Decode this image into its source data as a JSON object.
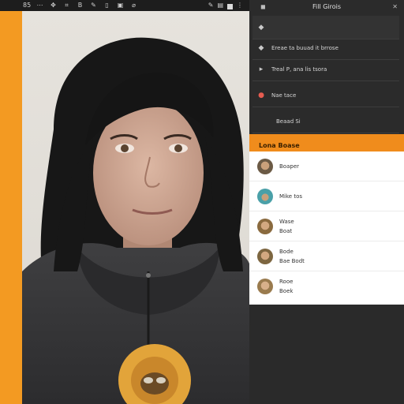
{
  "toolbar": {
    "zoom_label": "85",
    "tools": [
      {
        "icon": "grid-icon",
        "glyph": "⋯"
      },
      {
        "icon": "move-icon",
        "glyph": "✥"
      },
      {
        "icon": "crop-icon",
        "glyph": "⌗"
      },
      {
        "icon": "text-icon",
        "glyph": "B"
      },
      {
        "icon": "brush-icon",
        "glyph": "✎"
      },
      {
        "icon": "eraser-icon",
        "glyph": "▯"
      },
      {
        "icon": "bucket-icon",
        "glyph": "▣"
      },
      {
        "icon": "eyedropper-icon",
        "glyph": "⌀"
      }
    ]
  },
  "panel": {
    "title": "Fill Girois",
    "menu": [
      {
        "icon": "tag-icon",
        "glyph": "◆",
        "label": ""
      },
      {
        "icon": "shape-icon",
        "glyph": "◆",
        "label": "Ereae ta buuad it brrose"
      },
      {
        "icon": "pointer-icon",
        "glyph": "▸",
        "label": "Treal P, ana lis tsora"
      },
      {
        "icon": "eye-icon",
        "glyph": "●",
        "label": "Nae tace"
      },
      {
        "icon": "",
        "glyph": "",
        "label": "Beaad Si"
      }
    ],
    "section_header": "Lona Boase",
    "people": [
      {
        "name": "Boaper",
        "sub": "",
        "avatar_color": "#6b5a45"
      },
      {
        "name": "Mike tos",
        "sub": "",
        "avatar_color": "#4aa0a8"
      },
      {
        "name": "Wase",
        "sub": "Boat",
        "avatar_color": "#8a6a3e"
      },
      {
        "name": "Bode",
        "sub": "Bae Bodt",
        "avatar_color": "#7d6640"
      },
      {
        "name": "Rooe",
        "sub": "Boek",
        "avatar_color": "#9a7b4e"
      }
    ]
  },
  "colors": {
    "accent": "#f08c1c",
    "panel_dark": "#2b2b2b",
    "toolbar": "#1d1d1d"
  }
}
